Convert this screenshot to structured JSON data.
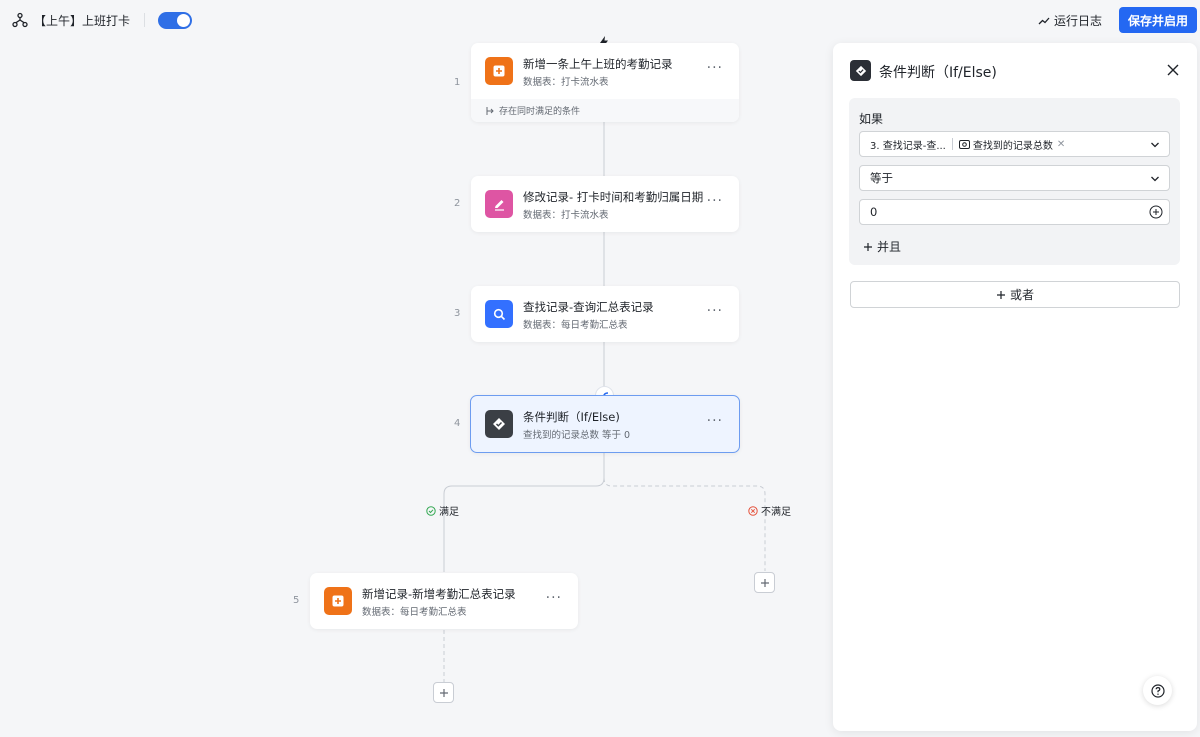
{
  "header": {
    "workflow_title": "【上午】上班打卡",
    "enabled": true,
    "run_log_label": "运行日志",
    "save_button_label": "保存并启用"
  },
  "nodes": [
    {
      "step": "1",
      "title": "新增一条上午上班的考勤记录",
      "subtitle": "数据表：打卡流水表",
      "icon": "add-record-icon",
      "color": "#ef7218",
      "footer": "存在同时满足的条件"
    },
    {
      "step": "2",
      "title": "修改记录- 打卡时间和考勤归属日期",
      "subtitle": "数据表：打卡流水表",
      "icon": "edit-record-icon",
      "color": "#de55a3"
    },
    {
      "step": "3",
      "title": "查找记录-查询汇总表记录",
      "subtitle": "数据表：每日考勤汇总表",
      "icon": "search-record-icon",
      "color": "#3370ff"
    },
    {
      "step": "4",
      "title": "条件判断（If/Else)",
      "subtitle": "查找到的记录总数 等于 0",
      "icon": "condition-icon",
      "color": "#3b3f45"
    },
    {
      "step": "5",
      "title": "新增记录-新增考勤汇总表记录",
      "subtitle": "数据表：每日考勤汇总表",
      "icon": "add-record-icon",
      "color": "#ef7218"
    }
  ],
  "branches": {
    "yes_label": "满足",
    "no_label": "不满足"
  },
  "panel": {
    "title": "条件判断（If/Else)",
    "if_label": "如果",
    "condition_field_tag": "3. 查找记录-查...",
    "condition_field_value": "查找到的记录总数",
    "operator": "等于",
    "value": "0",
    "and_label": "并且",
    "or_label": "或者"
  }
}
